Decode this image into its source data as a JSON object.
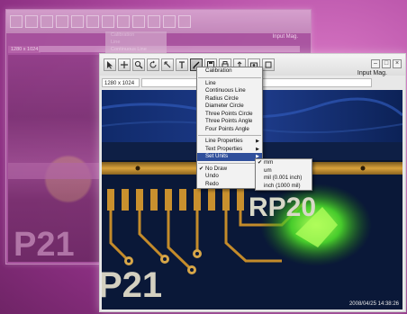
{
  "ghost": {
    "input_mag": "Input Mag.",
    "resolution": "1280 x 1024",
    "menu_items": [
      "Calibration",
      "Line",
      "Continuous Line"
    ],
    "image_text": "P21"
  },
  "window": {
    "resolution": "1280 x 1024",
    "input_mag_label": "Input Mag.",
    "timestamp": "2008/04/25 14:38:26",
    "image_texts": {
      "rp20": "RP20",
      "p21": "P21"
    }
  },
  "toolbar": {
    "tools": [
      {
        "icon": "arrow-icon"
      },
      {
        "icon": "pan-icon"
      },
      {
        "icon": "zoom-icon"
      },
      {
        "icon": "rotate-icon"
      },
      {
        "icon": "select-icon"
      },
      {
        "icon": "text-icon"
      },
      {
        "icon": "measure-icon"
      },
      {
        "icon": "save-icon"
      },
      {
        "icon": "print-icon"
      },
      {
        "icon": "export-icon"
      },
      {
        "icon": "camera-icon"
      },
      {
        "icon": "settings-icon"
      }
    ],
    "active_index": 6
  },
  "menu": {
    "items": [
      {
        "label": "Calibration"
      },
      {
        "label": "Line"
      },
      {
        "label": "Continuous Line"
      },
      {
        "label": "Radius Circle"
      },
      {
        "label": "Diameter Circle"
      },
      {
        "label": "Three Points Circle"
      },
      {
        "label": "Three Points Angle"
      },
      {
        "label": "Four Points Angle"
      },
      {
        "label": "Line Properties"
      },
      {
        "label": "Text Properties"
      },
      {
        "label": "Set Units"
      },
      {
        "label": "No Draw"
      },
      {
        "label": "Undo"
      },
      {
        "label": "Redo"
      }
    ],
    "highlighted": "Set Units",
    "checked": "No Draw"
  },
  "units_submenu": {
    "items": [
      {
        "label": "mm"
      },
      {
        "label": "um"
      },
      {
        "label": "mil (0.001 inch)"
      },
      {
        "label": "inch (1000 mil)"
      }
    ],
    "checked": "mm"
  },
  "colors": {
    "background": "#b54fa6",
    "menu_highlight": "#2f4f9b",
    "glow": "#7dff3a"
  }
}
